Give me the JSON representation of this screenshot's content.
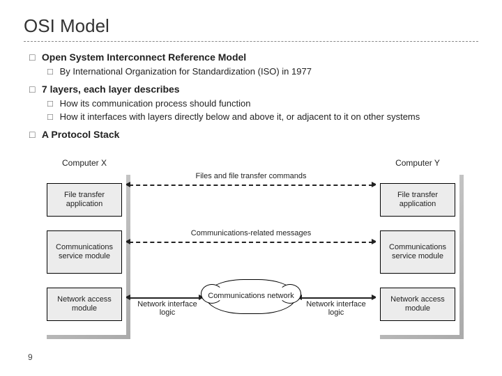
{
  "title": "OSI Model",
  "bullets": [
    {
      "text": "Open System Interconnect Reference Model",
      "bold": true,
      "sub": [
        {
          "text": "By International Organization for Standardization (ISO) in 1977"
        }
      ]
    },
    {
      "text": "7 layers, each layer describes",
      "bold": true,
      "sub": [
        {
          "text": "How its communication process should function"
        },
        {
          "text": "How it interfaces with layers directly below and above it, or adjacent to it on other systems"
        }
      ]
    },
    {
      "text": "A Protocol Stack",
      "bold": true,
      "sub": []
    }
  ],
  "diagram": {
    "left_label": "Computer X",
    "right_label": "Computer Y",
    "layers": [
      "File transfer application",
      "Communications service module",
      "Network access module"
    ],
    "link1": "Files and file transfer commands",
    "link2": "Communications-related messages",
    "cloud": "Communications network",
    "nil": "Network interface logic"
  },
  "page_number": "9"
}
